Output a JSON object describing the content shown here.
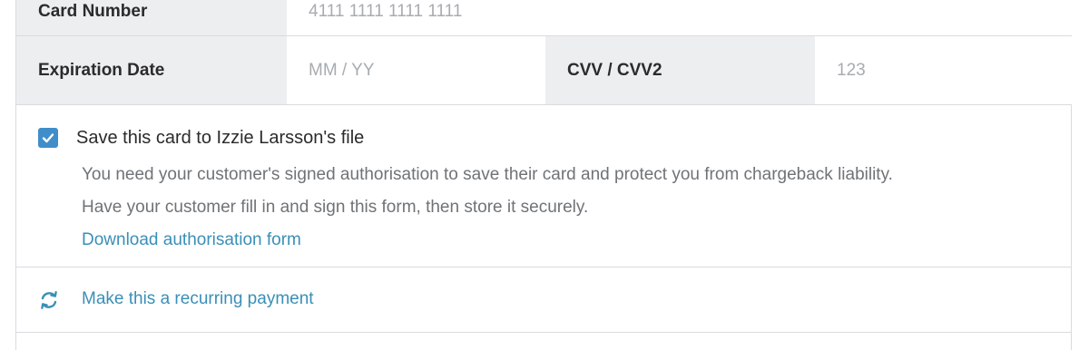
{
  "card_row": {
    "label": "Card Number",
    "placeholder": "4111 1111 1111 1111"
  },
  "expiration_row": {
    "expiry_label": "Expiration Date",
    "expiry_placeholder": "MM / YY",
    "cvv_label": "CVV / CVV2",
    "cvv_placeholder": "123"
  },
  "save_card": {
    "checked": true,
    "label": "Save this card to Izzie Larsson's file",
    "help_line1": "You need your customer's signed authorisation to save their card and protect you from chargeback liability.",
    "help_line2": "Have your customer fill in and sign this form, then store it securely.",
    "download_link": "Download authorisation form"
  },
  "recurring": {
    "icon": "recurring-arrows-icon",
    "link": "Make this a recurring payment"
  },
  "colors": {
    "accent_blue": "#3f8ec9",
    "link_blue": "#3a8fb7",
    "label_bg": "#eceef0"
  }
}
